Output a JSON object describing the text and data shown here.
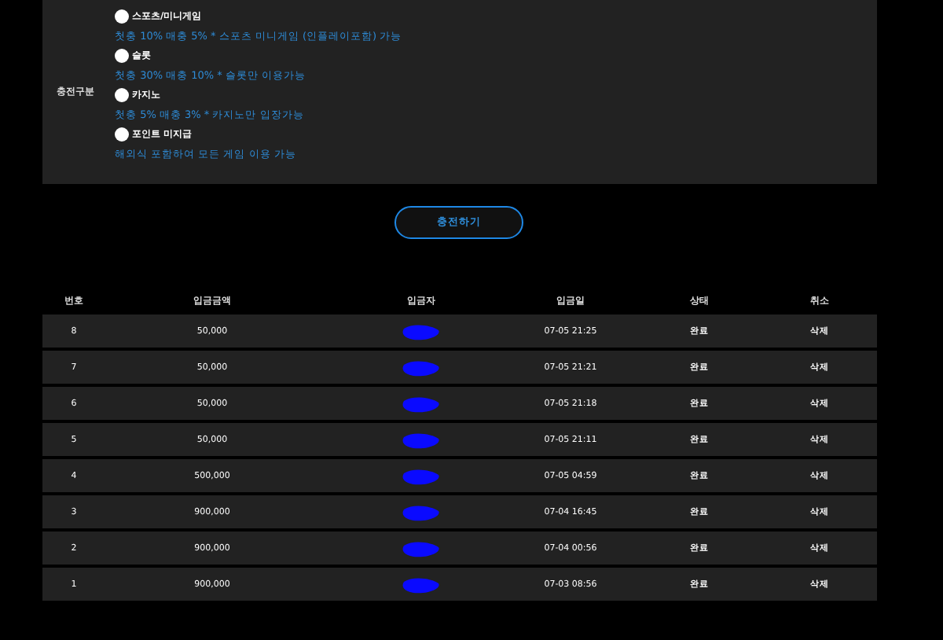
{
  "charge_type": {
    "label": "충전구분",
    "options": [
      {
        "name": "스포츠/미니게임",
        "selected": false,
        "description": "첫충 10% 매충 5% * 스포츠 미니게임 (인플레이포함) 가능"
      },
      {
        "name": "슬롯",
        "selected": false,
        "description": "첫충 30% 매충 10% * 슬롯만 이용가능"
      },
      {
        "name": "카지노",
        "selected": false,
        "description": "첫충 5% 매충 3% * 카지노만 입장가능"
      },
      {
        "name": "포인트 미지급",
        "selected": false,
        "description": "해외식 포함하여 모든 게임 이용 가능"
      }
    ]
  },
  "submit_button": "충전하기",
  "table": {
    "columns": [
      "번호",
      "입금금액",
      "입금자",
      "입금일",
      "상태",
      "취소"
    ],
    "rows": [
      {
        "no": "8",
        "amount": "50,000",
        "date": "07-05 21:25",
        "status": "완료",
        "cancel": "삭제"
      },
      {
        "no": "7",
        "amount": "50,000",
        "date": "07-05 21:21",
        "status": "완료",
        "cancel": "삭제"
      },
      {
        "no": "6",
        "amount": "50,000",
        "date": "07-05 21:18",
        "status": "완료",
        "cancel": "삭제"
      },
      {
        "no": "5",
        "amount": "50,000",
        "date": "07-05 21:11",
        "status": "완료",
        "cancel": "삭제"
      },
      {
        "no": "4",
        "amount": "500,000",
        "date": "07-05 04:59",
        "status": "완료",
        "cancel": "삭제"
      },
      {
        "no": "3",
        "amount": "900,000",
        "date": "07-04 16:45",
        "status": "완료",
        "cancel": "삭제"
      },
      {
        "no": "2",
        "amount": "900,000",
        "date": "07-04 00:56",
        "status": "완료",
        "cancel": "삭제"
      },
      {
        "no": "1",
        "amount": "900,000",
        "date": "07-03 08:56",
        "status": "완료",
        "cancel": "삭제"
      }
    ]
  }
}
